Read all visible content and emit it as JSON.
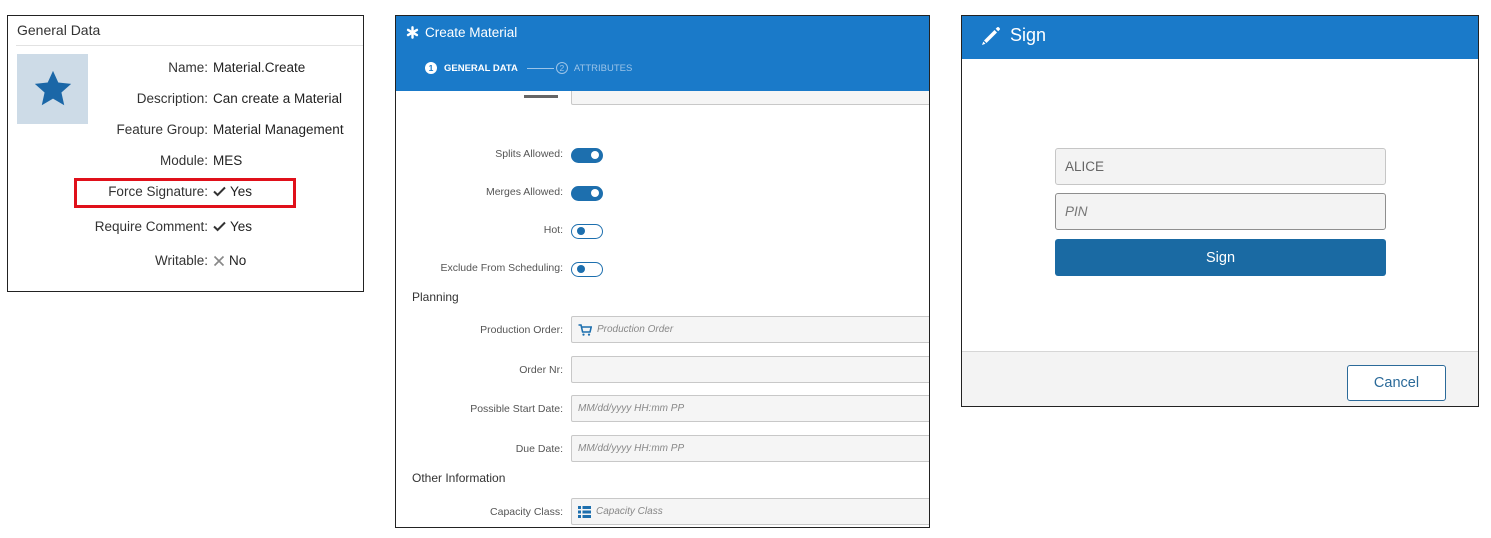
{
  "general_data": {
    "title": "General Data",
    "thumbnail_icon": "star-icon",
    "rows": [
      {
        "label": "Name:",
        "value": "Material.Create"
      },
      {
        "label": "Description:",
        "value": "Can create a Material"
      },
      {
        "label": "Feature Group:",
        "value": "Material Management"
      },
      {
        "label": "Module:",
        "value": "MES"
      },
      {
        "label": "Force Signature:",
        "value": "Yes",
        "icon": "check-icon"
      },
      {
        "label": "Require Comment:",
        "value": "Yes",
        "icon": "check-icon"
      },
      {
        "label": "Writable:",
        "value": "No",
        "icon": "cross-icon"
      }
    ],
    "highlight_color": "#e0101a"
  },
  "create_material": {
    "title": "Create Material",
    "steps": [
      {
        "number": "1",
        "label": "GENERAL DATA",
        "active": true
      },
      {
        "number": "2",
        "label": "ATTRIBUTES",
        "active": false
      }
    ],
    "toggles": [
      {
        "label": "Splits Allowed:",
        "on": true
      },
      {
        "label": "Merges Allowed:",
        "on": true
      },
      {
        "label": "Hot:",
        "on": false
      },
      {
        "label": "Exclude From Scheduling:",
        "on": false
      }
    ],
    "sections": {
      "planning": "Planning",
      "other": "Other Information"
    },
    "fields": {
      "production_order": {
        "label": "Production Order:",
        "placeholder": "Production Order"
      },
      "order_nr": {
        "label": "Order Nr:",
        "placeholder": ""
      },
      "possible_start_date": {
        "label": "Possible Start Date:",
        "placeholder": "MM/dd/yyyy HH:mm PP"
      },
      "due_date": {
        "label": "Due Date:",
        "placeholder": "MM/dd/yyyy HH:mm PP"
      },
      "capacity_class": {
        "label": "Capacity Class:",
        "placeholder": "Capacity Class"
      }
    },
    "accent_color": "#1a7ac9"
  },
  "sign_dialog": {
    "title": "Sign",
    "username_value": "ALICE",
    "pin_placeholder": "PIN",
    "sign_label": "Sign",
    "cancel_label": "Cancel",
    "accent_color": "#1a7ac9"
  }
}
